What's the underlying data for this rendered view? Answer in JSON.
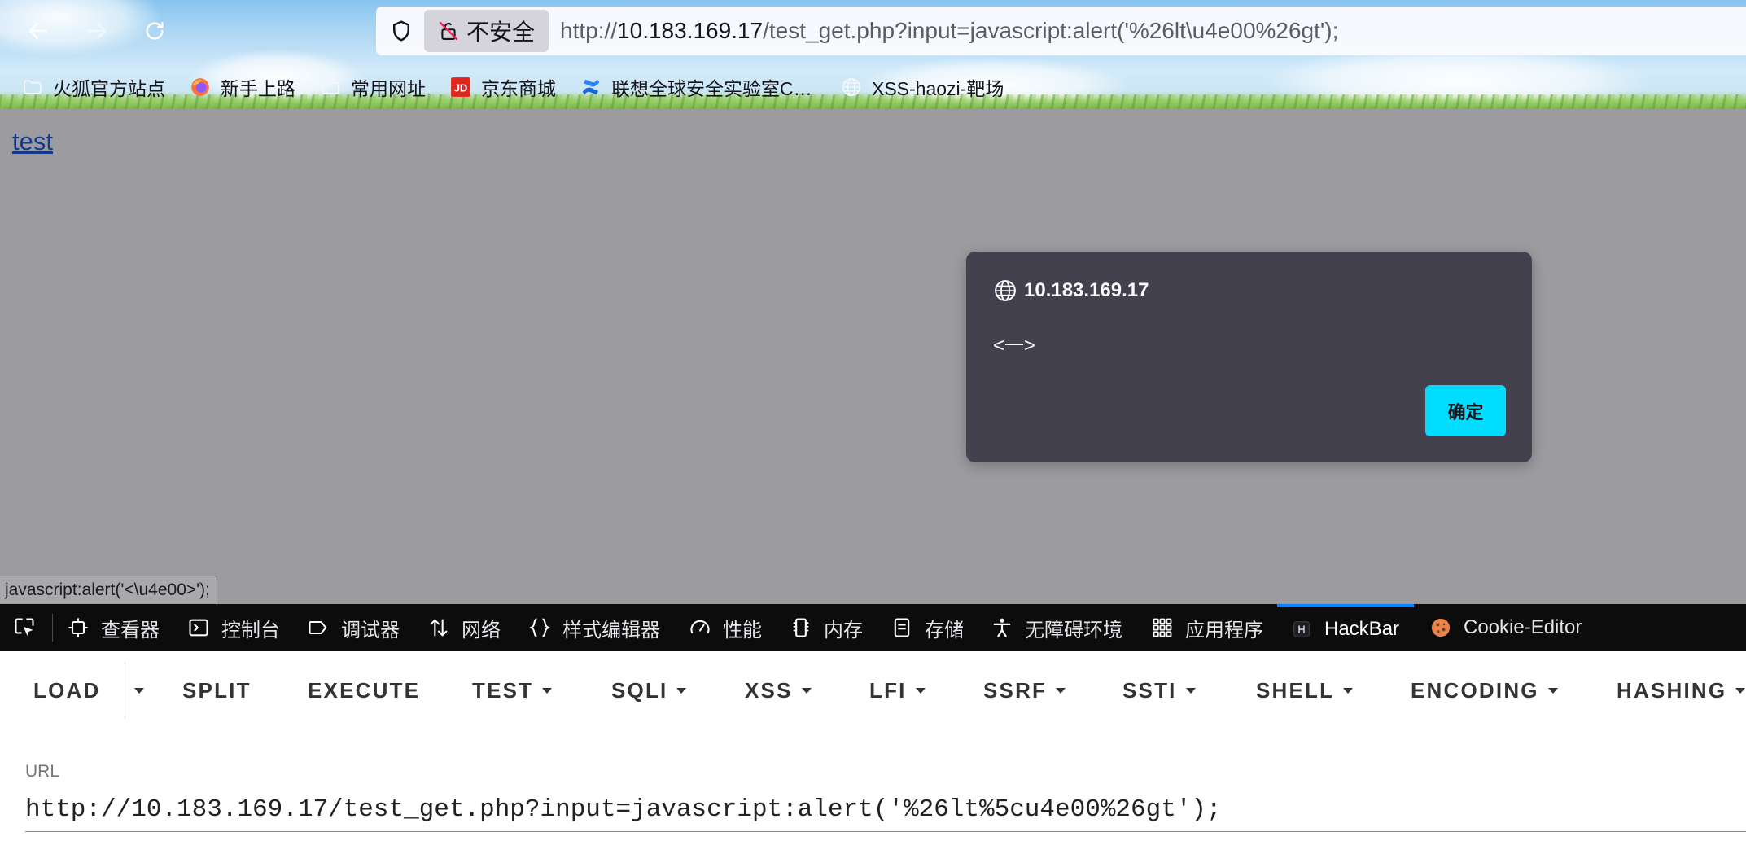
{
  "window": {
    "nav": {
      "back_icon": "arrow-left-icon",
      "forward_icon": "arrow-right-icon",
      "reload_icon": "reload-icon"
    },
    "urlbar": {
      "tracking_icon": "shield-icon",
      "security_icon": "insecure-lock-icon",
      "security_label": "不安全",
      "url_scheme": "http://",
      "url_host": "10.183.169.17",
      "url_rest": "/test_get.php?input=javascript:alert('%26lt\\u4e00%26gt');"
    },
    "bookmarks": [
      {
        "label": "火狐官方站点",
        "icon": "folder-icon"
      },
      {
        "label": "新手上路",
        "icon": "firefox-icon"
      },
      {
        "label": "常用网址",
        "icon": "folder-icon"
      },
      {
        "label": "京东商城",
        "icon": "jd-icon",
        "logo_text": "JD"
      },
      {
        "label": "联想全球安全实验室C…",
        "icon": "confluence-icon"
      },
      {
        "label": "XSS-haozi-靶场",
        "icon": "globe-icon"
      }
    ]
  },
  "page": {
    "link_text": "test"
  },
  "alert_dialog": {
    "icon": "globe-icon",
    "origin": "10.183.169.17",
    "message": "<一>",
    "ok_label": "确定"
  },
  "status_panel": {
    "text": "javascript:alert('<\\u4e00>');"
  },
  "devtools": {
    "picker_icon": "element-picker-icon",
    "tabs": [
      {
        "label": "查看器",
        "icon": "inspector-icon"
      },
      {
        "label": "控制台",
        "icon": "console-icon"
      },
      {
        "label": "调试器",
        "icon": "debugger-icon"
      },
      {
        "label": "网络",
        "icon": "network-icon"
      },
      {
        "label": "样式编辑器",
        "icon": "style-editor-icon"
      },
      {
        "label": "性能",
        "icon": "performance-icon"
      },
      {
        "label": "内存",
        "icon": "memory-icon"
      },
      {
        "label": "存储",
        "icon": "storage-icon"
      },
      {
        "label": "无障碍环境",
        "icon": "accessibility-icon"
      },
      {
        "label": "应用程序",
        "icon": "application-icon"
      },
      {
        "label": "HackBar",
        "icon": "hackbar-icon",
        "selected": true
      },
      {
        "label": "Cookie-Editor",
        "icon": "cookie-icon"
      }
    ]
  },
  "hackbar": {
    "buttons": [
      {
        "label": "LOAD",
        "menu": false
      },
      {
        "label": "SPLIT",
        "menu": false
      },
      {
        "label": "EXECUTE",
        "menu": false
      },
      {
        "label": "TEST",
        "menu": true
      },
      {
        "label": "SQLI",
        "menu": true
      },
      {
        "label": "XSS",
        "menu": true
      },
      {
        "label": "LFI",
        "menu": true
      },
      {
        "label": "SSRF",
        "menu": true
      },
      {
        "label": "SSTI",
        "menu": true
      },
      {
        "label": "SHELL",
        "menu": true
      },
      {
        "label": "ENCODING",
        "menu": true
      },
      {
        "label": "HASHING",
        "menu": true
      }
    ],
    "load_menu_icon": "caret-down-icon",
    "url_label": "URL",
    "url_value": "http://10.183.169.17/test_get.php?input=javascript:alert('%26lt%5cu4e00%26gt');"
  },
  "colors": {
    "devtools_bg": "#0c0c0d",
    "selected_tab_accent": "#0a84ff",
    "dialog_bg": "#42414d",
    "dialog_button": "#00ddff",
    "page_dimmed_bg": "#9c9ca0",
    "link": "#13398f"
  }
}
